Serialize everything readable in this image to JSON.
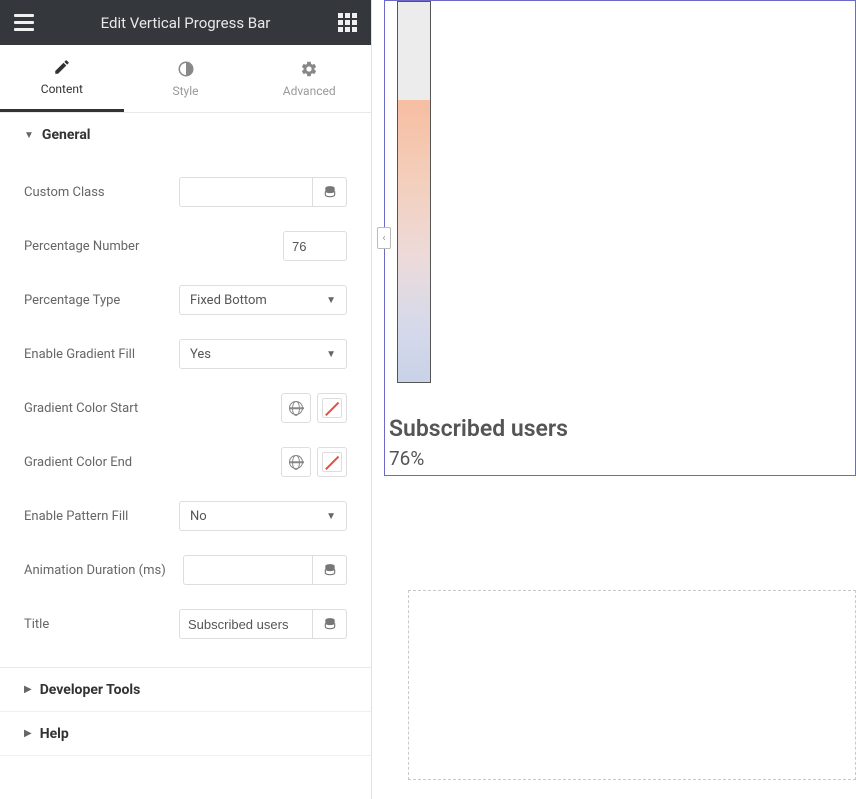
{
  "header": {
    "title": "Edit Vertical Progress Bar"
  },
  "tabs": {
    "content": "Content",
    "style": "Style",
    "advanced": "Advanced"
  },
  "sections": {
    "general": {
      "title": "General",
      "fields": {
        "custom_class_label": "Custom Class",
        "custom_class_value": "",
        "percentage_number_label": "Percentage Number",
        "percentage_number_value": "76",
        "percentage_type_label": "Percentage Type",
        "percentage_type_value": "Fixed Bottom",
        "enable_gradient_label": "Enable Gradient Fill",
        "enable_gradient_value": "Yes",
        "gradient_start_label": "Gradient Color Start",
        "gradient_end_label": "Gradient Color End",
        "enable_pattern_label": "Enable Pattern Fill",
        "enable_pattern_value": "No",
        "animation_label": "Animation Duration (ms)",
        "animation_value": "",
        "title_label": "Title",
        "title_value": "Subscribed users"
      }
    },
    "developer_tools": {
      "title": "Developer Tools"
    },
    "help": {
      "title": "Help"
    }
  },
  "preview": {
    "title": "Subscribed users",
    "percent_text": "76%"
  }
}
